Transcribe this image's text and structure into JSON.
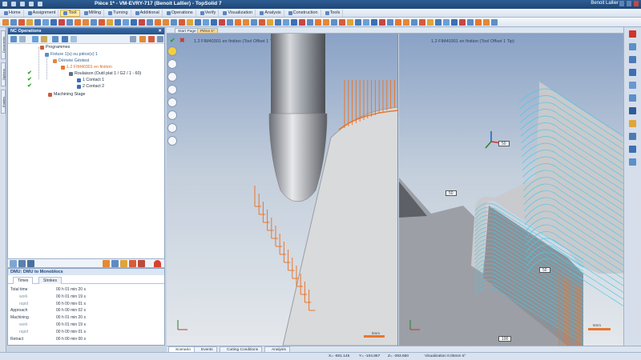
{
  "window": {
    "title": "Pièce 1* - VM-EVRY-717 (Benoit Lallier) - TopSolid 7",
    "user": "Benoit Lallier"
  },
  "menu": [
    {
      "label": "Home",
      "active": false
    },
    {
      "label": "Assignment",
      "active": false
    },
    {
      "label": "Tool",
      "active": true
    },
    {
      "label": "Milling",
      "active": false
    },
    {
      "label": "Turning",
      "active": false
    },
    {
      "label": "Additional",
      "active": false
    },
    {
      "label": "Operations",
      "active": false
    },
    {
      "label": "Verify",
      "active": false
    },
    {
      "label": "Visualization",
      "active": false
    },
    {
      "label": "Analysis",
      "active": false
    },
    {
      "label": "Construction",
      "active": false
    },
    {
      "label": "Tools",
      "active": false
    }
  ],
  "left_tabs": [
    "Documents",
    "Options",
    "Entities"
  ],
  "nc_panel": {
    "title": "NC Operations",
    "tree": [
      {
        "label": "Programmes",
        "checked": false
      },
      {
        "label": "Fixture 1(s) ou pièce(s) 1",
        "checked": false
      },
      {
        "label": "Dérivée Géotest",
        "checked": false
      },
      {
        "label": "1.2 FIM40301 en finition",
        "checked": false
      },
      {
        "label": "Roulaison (Outil plat 1 / G2 / 1 - 60)",
        "checked": true
      },
      {
        "label": "1 Contact 1",
        "checked": true
      },
      {
        "label": "2 Contact 2",
        "checked": true
      },
      {
        "label": "Machining Stage",
        "checked": false
      }
    ]
  },
  "dmu": {
    "header": "DMU: DMU to Monoblocs",
    "tabs": [
      "Times",
      "Strokes"
    ],
    "rows": [
      {
        "label": "Total time",
        "value": "00 h 01 min 20 s",
        "sub": false
      },
      {
        "label": "work",
        "value": "00 h 01 min 19 s",
        "sub": true
      },
      {
        "label": "rapid",
        "value": "00 h 00 min 01 s",
        "sub": true
      },
      {
        "label": "Approach",
        "value": "00 h 00 min 02 s",
        "sub": false
      },
      {
        "label": "Machining",
        "value": "00 h 01 min 20 s",
        "sub": false
      },
      {
        "label": "work",
        "value": "00 h 01 min 19 s",
        "sub": true
      },
      {
        "label": "rapid",
        "value": "00 h 00 min 01 s",
        "sub": true
      },
      {
        "label": "Retract",
        "value": "00 h 00 min 00 s",
        "sub": false
      }
    ]
  },
  "view_tabs": [
    {
      "label": "Start Page",
      "selected": false
    },
    {
      "label": "Pièce 1*",
      "selected": true
    }
  ],
  "views": [
    {
      "title": "1.2 FIM40301 en finition (Tool Offset 1 Tip)",
      "scale_label": "5mm"
    },
    {
      "title": "1.2 FIM40301 en finition (Tool Offset 1 Tip)",
      "scale_label": "5mm",
      "badges": [
        "50",
        "50",
        "100"
      ],
      "marker": "50"
    }
  ],
  "bottom_tabs": [
    {
      "label": "Scenario",
      "selected": true
    },
    {
      "label": "Events",
      "selected": false
    },
    {
      "label": "Cutting Conditions",
      "selected": false
    },
    {
      "label": "Analysis",
      "selected": false
    }
  ],
  "status": {
    "x": "X= -801.145",
    "y": "Y= -104.867",
    "z": "Z= -393.660",
    "visualization": "Visualization 0.05mm 5°"
  },
  "colors": {
    "accent": "#2d5c93",
    "toolpath_orange": "#e8772e",
    "toolpath_cyan": "#4fc6e4",
    "check": "#2aa52a"
  }
}
